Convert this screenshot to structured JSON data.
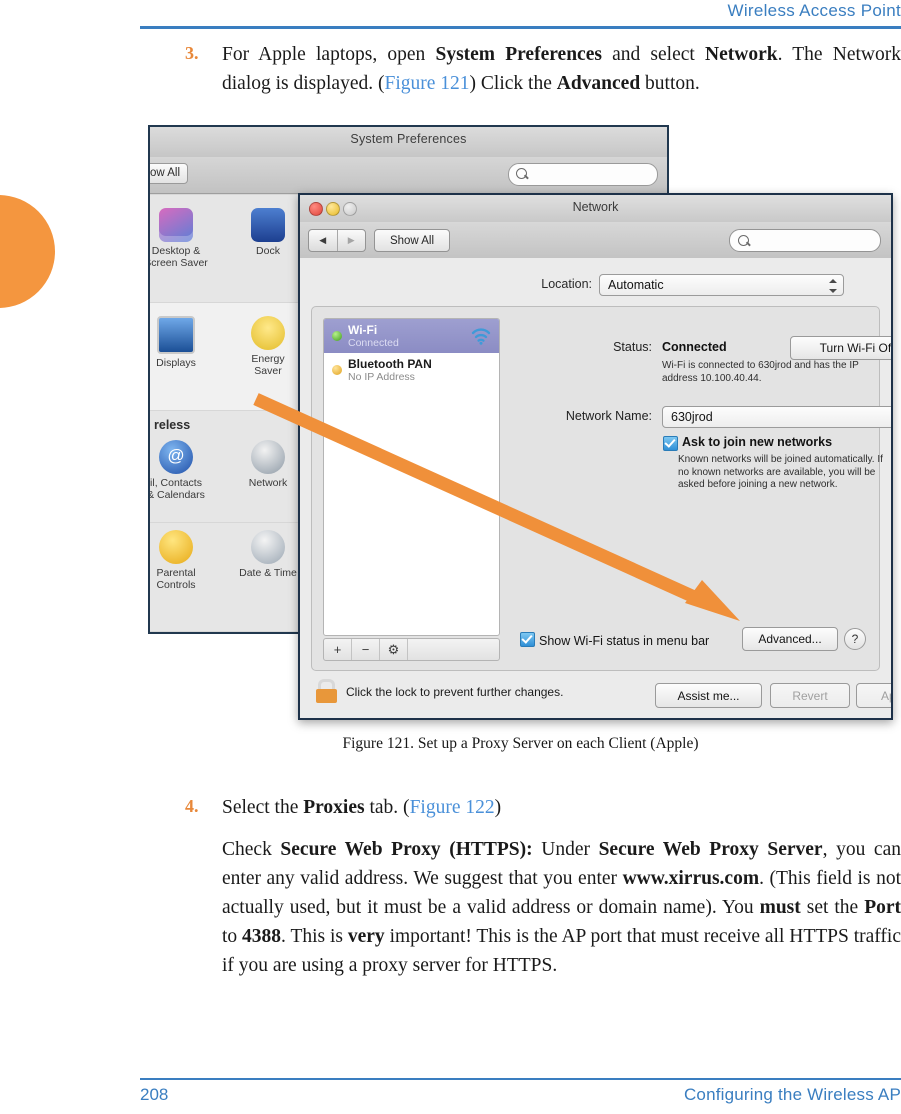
{
  "page": {
    "header_title": "Wireless Access Point",
    "footer_page_number": "208",
    "footer_section": "Configuring the Wireless AP",
    "accent_blue": "#3a7ec0",
    "accent_orange": "#f4963f"
  },
  "steps": [
    {
      "number": "3.",
      "text_parts": [
        {
          "t": "For Apple laptops, open ",
          "style": "normal"
        },
        {
          "t": "System Preferences",
          "style": "bold"
        },
        {
          "t": " and select ",
          "style": "normal"
        },
        {
          "t": "Network",
          "style": "bold"
        },
        {
          "t": ". The Network dialog is displayed. (",
          "style": "normal"
        },
        {
          "t": "Figure 121",
          "style": "xref"
        },
        {
          "t": ") Click the ",
          "style": "normal"
        },
        {
          "t": "Advanced",
          "style": "bold"
        },
        {
          "t": " button.",
          "style": "normal"
        }
      ]
    },
    {
      "number": "4.",
      "text_parts": [
        {
          "t": "Select the ",
          "style": "normal"
        },
        {
          "t": "Proxies",
          "style": "bold"
        },
        {
          "t": " tab. (",
          "style": "normal"
        },
        {
          "t": "Figure 122",
          "style": "xref"
        },
        {
          "t": ")",
          "style": "normal"
        }
      ]
    }
  ],
  "paragraph": {
    "text_parts": [
      {
        "t": "Check ",
        "style": "normal"
      },
      {
        "t": "Secure Web Proxy (HTTPS):",
        "style": "bold"
      },
      {
        "t": " Under ",
        "style": "normal"
      },
      {
        "t": "Secure Web Proxy Server",
        "style": "bold"
      },
      {
        "t": ", you can enter any valid address. We suggest that you enter ",
        "style": "normal"
      },
      {
        "t": "www.xirrus.com",
        "style": "bold"
      },
      {
        "t": ". (This field is not actually used, but it must be a valid address or domain name). You ",
        "style": "normal"
      },
      {
        "t": "must",
        "style": "bold"
      },
      {
        "t": " set the ",
        "style": "normal"
      },
      {
        "t": "Port",
        "style": "bold"
      },
      {
        "t": " to ",
        "style": "normal"
      },
      {
        "t": "4388",
        "style": "bold"
      },
      {
        "t": ". This is ",
        "style": "normal"
      },
      {
        "t": "very",
        "style": "bold"
      },
      {
        "t": " important! This is the AP port that must receive all HTTPS traffic if you are using a proxy server for HTTPS.",
        "style": "normal"
      }
    ]
  },
  "figure": {
    "caption": "Figure 121. Set up a Proxy Server on each Client (Apple)",
    "system_preferences": {
      "title": "System Preferences",
      "show_all_label": "ow All",
      "search_placeholder": "",
      "groups": [
        {
          "label": "",
          "items": [
            {
              "name": "Desktop &\nScreen Saver",
              "icon": "desktop-screensaver-icon"
            },
            {
              "name": "Dock",
              "icon": "dock-icon"
            }
          ]
        },
        {
          "label": "",
          "items": [
            {
              "name": "Displays",
              "icon": "displays-icon"
            },
            {
              "name": "Energy\nSaver",
              "icon": "energy-saver-icon"
            }
          ]
        },
        {
          "label": "reless",
          "items": [
            {
              "name": "il, Contacts\n& Calendars",
              "icon": "mail-contacts-calendars-icon"
            },
            {
              "name": "Network",
              "icon": "network-icon"
            }
          ]
        },
        {
          "label": "",
          "items": [
            {
              "name": "Parental\nControls",
              "icon": "parental-controls-icon"
            },
            {
              "name": "Date & Time",
              "icon": "date-time-icon"
            }
          ]
        }
      ]
    },
    "network_window": {
      "title": "Network",
      "show_all_label": "Show All",
      "back_icon": "back-arrow-icon",
      "forward_icon": "forward-arrow-icon",
      "search_placeholder": "",
      "location_label": "Location:",
      "location_value": "Automatic",
      "services": [
        {
          "name": "Wi-Fi",
          "status": "Connected",
          "dot": "green",
          "badge": "wifi-icon",
          "selected": true
        },
        {
          "name": "Bluetooth PAN",
          "status": "No IP Address",
          "dot": "amber",
          "badge": "bluetooth-icon",
          "selected": false
        }
      ],
      "list_buttons": [
        "+",
        "−",
        "⚙"
      ],
      "status_label": "Status:",
      "status_value": "Connected",
      "turn_off_button": "Turn Wi-Fi Off",
      "status_note": "Wi-Fi is connected to 630jrod and has the IP address 10.100.40.44.",
      "network_name_label": "Network Name:",
      "network_name_value": "630jrod",
      "ask_join_label": "Ask to join new networks",
      "ask_join_note": "Known networks will be joined automatically. If no known networks are available, you will be asked before joining a new network.",
      "show_status_label": "Show Wi-Fi status in menu bar",
      "advanced_button": "Advanced...",
      "help_button": "?",
      "lock_text": "Click the lock to prevent further changes.",
      "assist_button": "Assist me...",
      "revert_button": "Revert",
      "apply_button": "Apply"
    },
    "callout_arrow": {
      "from": "network-preference-pane-icon",
      "to": "advanced-button",
      "color": "#f0903a"
    }
  }
}
